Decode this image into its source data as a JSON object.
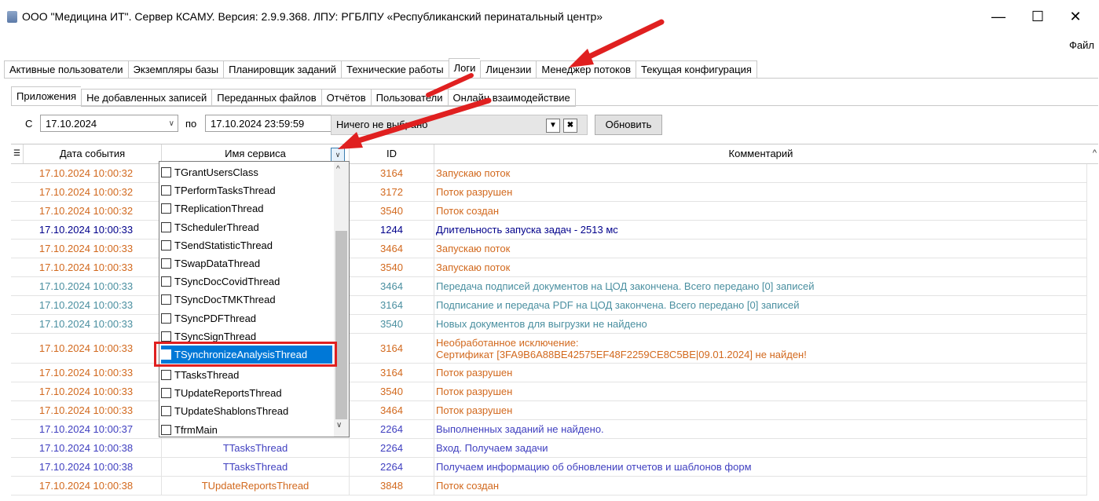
{
  "window": {
    "title": "ООО \"Медицина ИТ\". Сервер КСАМУ. Версия: 2.9.9.368. ЛПУ: РГБЛПУ «Республиканский перинатальный центр»",
    "minimize": "—",
    "maximize": "☐",
    "close": "✕",
    "menu_file": "Файл"
  },
  "main_tabs": [
    "Активные пользователи",
    "Экземпляры базы",
    "Планировщик заданий",
    "Технические работы",
    "Логи",
    "Лицензии",
    "Менеджер потоков",
    "Текущая конфигурация"
  ],
  "log_tabs": [
    "Приложения",
    "Не добавленных записей",
    "Переданных файлов",
    "Отчётов",
    "Пользователи",
    "Онлайн взаимодействие"
  ],
  "filter": {
    "from_label": "С",
    "from_value": "17.10.2024",
    "to_label": "по",
    "to_value": "17.10.2024 23:59:59",
    "service_value": "Ничего не выбрано",
    "refresh_label": "Обновить"
  },
  "grid": {
    "columns": [
      "Дата события",
      "Имя сервиса",
      "ID",
      "Комментарий"
    ],
    "rows": [
      {
        "date": "17.10.2024 10:00:32",
        "service": "",
        "id": "3164",
        "comment": "Запускаю поток",
        "color": "orange"
      },
      {
        "date": "17.10.2024 10:00:32",
        "service": "",
        "id": "3172",
        "comment": "Поток разрушен",
        "color": "orange"
      },
      {
        "date": "17.10.2024 10:00:32",
        "service": "",
        "id": "3540",
        "comment": "Поток создан",
        "color": "orange"
      },
      {
        "date": "17.10.2024 10:00:33",
        "service": "",
        "id": "1244",
        "comment": "Длительность запуска задач - 2513 мс",
        "color": "navy"
      },
      {
        "date": "17.10.2024 10:00:33",
        "service": "",
        "id": "3464",
        "comment": "Запускаю поток",
        "color": "orange"
      },
      {
        "date": "17.10.2024 10:00:33",
        "service": "",
        "id": "3540",
        "comment": "Запускаю поток",
        "color": "orange"
      },
      {
        "date": "17.10.2024 10:00:33",
        "service": "",
        "id": "3464",
        "comment": "Передача подписей документов на ЦОД закончена. Всего передано [0] записей",
        "color": "teal"
      },
      {
        "date": "17.10.2024 10:00:33",
        "service": "",
        "id": "3164",
        "comment": "Подписание и передача PDF на ЦОД закончена. Всего передано [0] записей",
        "color": "teal"
      },
      {
        "date": "17.10.2024 10:00:33",
        "service": "",
        "id": "3540",
        "comment": "Новых документов для выгрузки не найдено",
        "color": "teal"
      },
      {
        "date": "17.10.2024 10:00:33",
        "service": "",
        "id": "3164",
        "comment": "Необработанное исключение:",
        "comment2": "Сертификат [3FA9B6A88BE42575EF48F2259CE8C5BE|09.01.2024] не найден!",
        "color": "orange",
        "tall": true
      },
      {
        "date": "17.10.2024 10:00:33",
        "service": "",
        "id": "3164",
        "comment": "Поток разрушен",
        "color": "orange"
      },
      {
        "date": "17.10.2024 10:00:33",
        "service": "",
        "id": "3540",
        "comment": "Поток разрушен",
        "color": "orange"
      },
      {
        "date": "17.10.2024 10:00:33",
        "service": "",
        "id": "3464",
        "comment": "Поток разрушен",
        "color": "orange"
      },
      {
        "date": "17.10.2024 10:00:37",
        "service": "TTasksThread",
        "id": "2264",
        "comment": "Выполненных заданий не найдено.",
        "color": "blue"
      },
      {
        "date": "17.10.2024 10:00:38",
        "service": "TTasksThread",
        "id": "2264",
        "comment": "Вход. Получаем задачи",
        "color": "blue"
      },
      {
        "date": "17.10.2024 10:00:38",
        "service": "TTasksThread",
        "id": "2264",
        "comment": "Получаем информацию об обновлении отчетов и шаблонов форм",
        "color": "blue"
      },
      {
        "date": "17.10.2024 10:00:38",
        "service": "TUpdateReportsThread",
        "id": "3848",
        "comment": "Поток создан",
        "color": "orange"
      }
    ]
  },
  "service_dropdown": {
    "items": [
      "TGrantUsersClass",
      "TPerformTasksThread",
      "TReplicationThread",
      "TSchedulerThread",
      "TSendStatisticThread",
      "TSwapDataThread",
      "TSyncDocCovidThread",
      "TSyncDocTMKThread",
      "TSyncPDFThread",
      "TSyncSignThread",
      "TSynchronizeAnalysisThread",
      "TTasksThread",
      "TUpdateReportsThread",
      "TUpdateShablonsThread",
      "TfrmMain"
    ],
    "selected": "TSynchronizeAnalysisThread"
  },
  "colors": {
    "orange": "#d2691e",
    "navy": "#00008b",
    "teal": "#4a8fa0",
    "blue": "#4040c0",
    "selection": "#0078d7",
    "annotation": "#e02020"
  }
}
